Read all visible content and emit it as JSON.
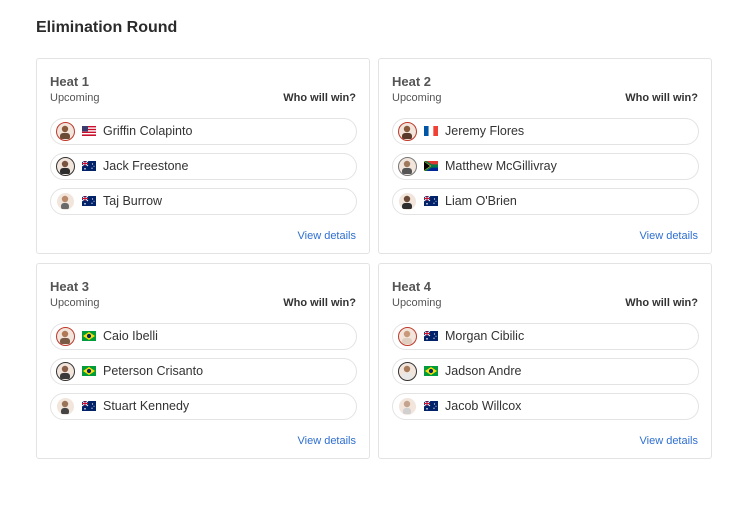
{
  "page": {
    "title": "Elimination Round"
  },
  "heats": [
    {
      "title": "Heat 1",
      "status": "Upcoming",
      "prompt": "Who will win?",
      "link": "View details",
      "surfers": [
        {
          "name": "Griffin Colapinto",
          "flag": "usa-flag-icon",
          "ring": "#c0392b"
        },
        {
          "name": "Jack Freestone",
          "flag": "australia-flag-icon",
          "ring": "#333333"
        },
        {
          "name": "Taj Burrow",
          "flag": "australia-flag-icon",
          "ring": "#ffffff"
        }
      ]
    },
    {
      "title": "Heat 2",
      "status": "Upcoming",
      "prompt": "Who will win?",
      "link": "View details",
      "surfers": [
        {
          "name": "Jeremy Flores",
          "flag": "france-flag-icon",
          "ring": "#c0392b"
        },
        {
          "name": "Matthew McGillivray",
          "flag": "south-africa-flag-icon",
          "ring": "#777777"
        },
        {
          "name": "Liam O'Brien",
          "flag": "australia-flag-icon",
          "ring": "#ffffff"
        }
      ]
    },
    {
      "title": "Heat 3",
      "status": "Upcoming",
      "prompt": "Who will win?",
      "link": "View details",
      "surfers": [
        {
          "name": "Caio Ibelli",
          "flag": "brazil-flag-icon",
          "ring": "#c0392b"
        },
        {
          "name": "Peterson Crisanto",
          "flag": "brazil-flag-icon",
          "ring": "#333333"
        },
        {
          "name": "Stuart Kennedy",
          "flag": "australia-flag-icon",
          "ring": "#ffffff"
        }
      ]
    },
    {
      "title": "Heat 4",
      "status": "Upcoming",
      "prompt": "Who will win?",
      "link": "View details",
      "surfers": [
        {
          "name": "Morgan Cibilic",
          "flag": "australia-flag-icon",
          "ring": "#c0392b"
        },
        {
          "name": "Jadson Andre",
          "flag": "brazil-flag-icon",
          "ring": "#333333"
        },
        {
          "name": "Jacob Willcox",
          "flag": "australia-flag-icon",
          "ring": "#ffffff"
        }
      ]
    }
  ],
  "colors": {
    "link": "#2f6fd0",
    "border": "#e3e3e3",
    "title": "#2b2b2b"
  }
}
